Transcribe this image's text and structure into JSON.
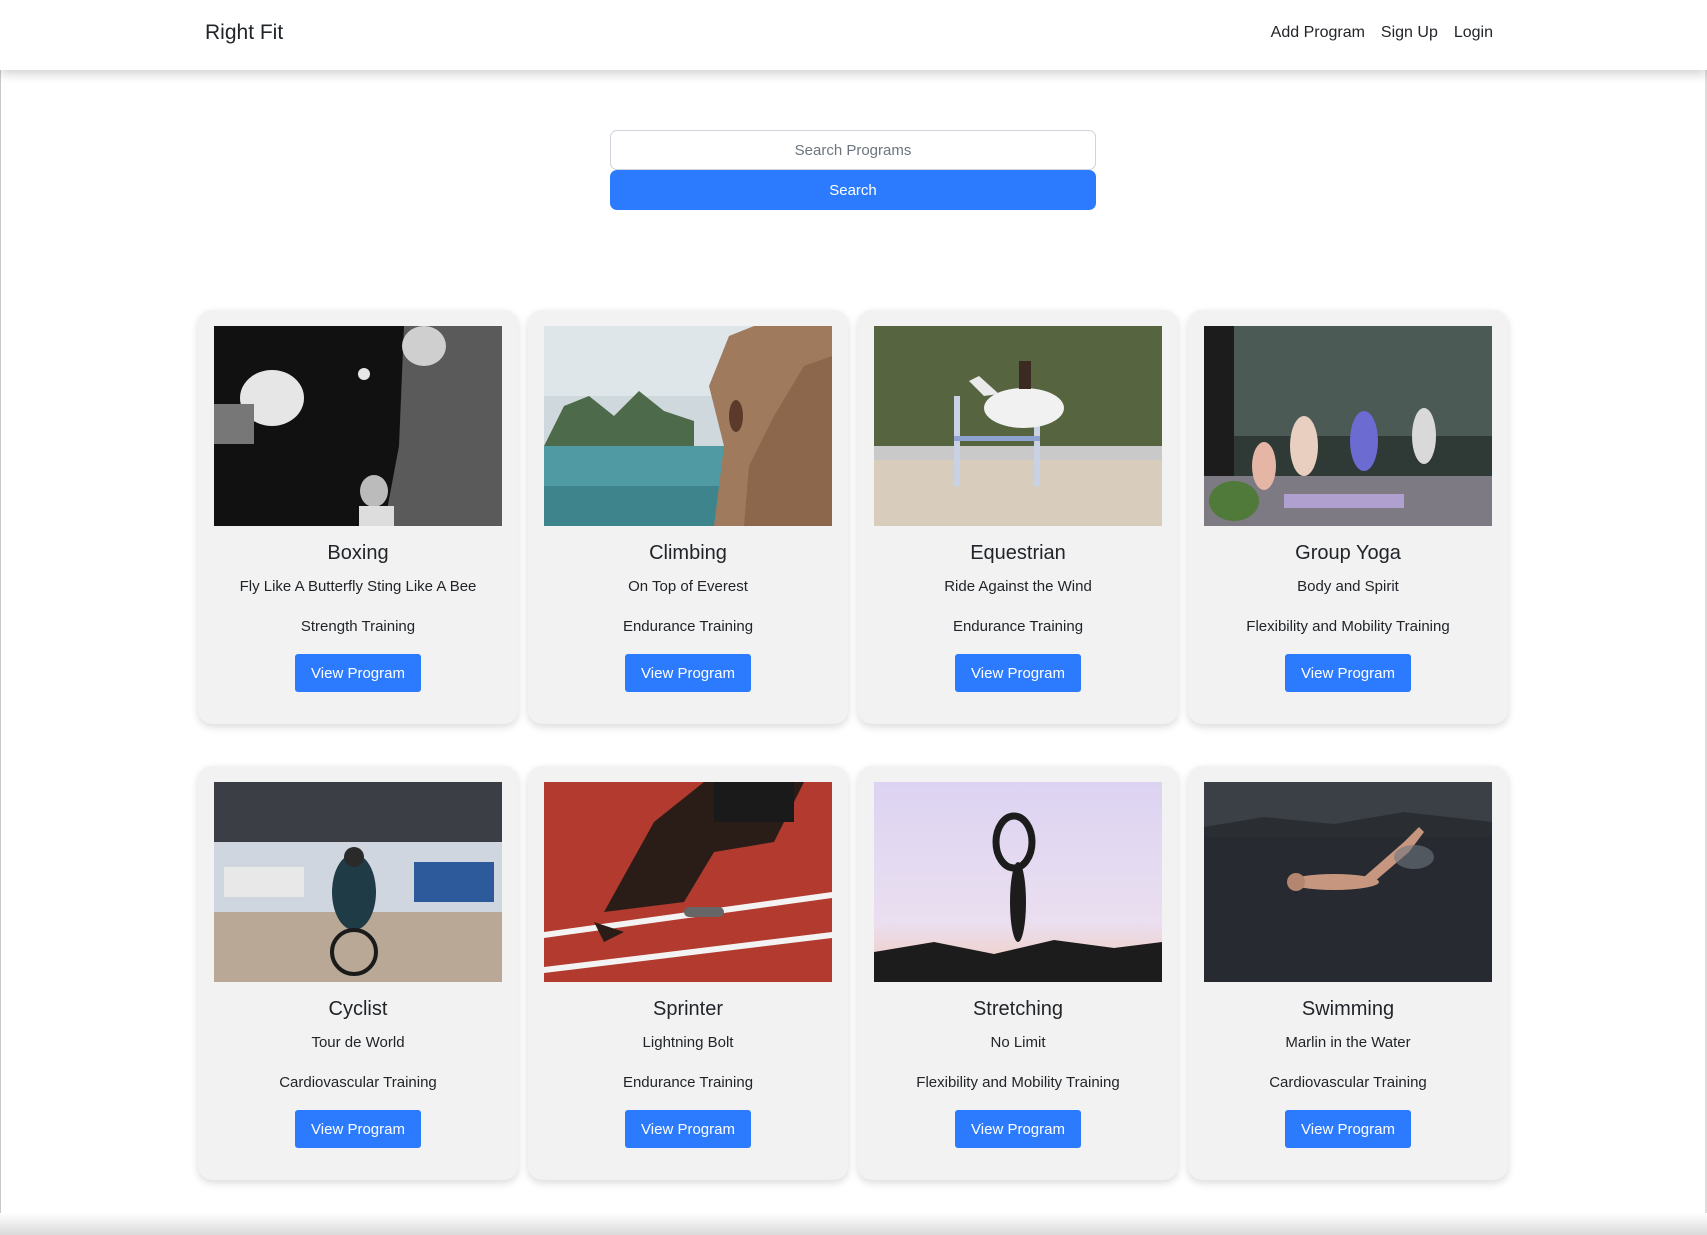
{
  "navbar": {
    "brand": "Right Fit",
    "links": [
      "Add Program",
      "Sign Up",
      "Login"
    ]
  },
  "search": {
    "placeholder": "Search Programs",
    "button_label": "Search"
  },
  "programs": [
    {
      "title": "Boxing",
      "tagline": "Fly Like A Butterfly Sting Like A Bee",
      "category": "Strength Training",
      "button": "View Program",
      "image": "boxing-photo"
    },
    {
      "title": "Climbing",
      "tagline": "On Top of Everest",
      "category": "Endurance Training",
      "button": "View Program",
      "image": "climbing-photo"
    },
    {
      "title": "Equestrian",
      "tagline": "Ride Against the Wind",
      "category": "Endurance Training",
      "button": "View Program",
      "image": "equestrian-photo"
    },
    {
      "title": "Group Yoga",
      "tagline": "Body and Spirit",
      "category": "Flexibility and Mobility Training",
      "button": "View Program",
      "image": "group-yoga-photo"
    },
    {
      "title": "Cyclist",
      "tagline": "Tour de World",
      "category": "Cardiovascular Training",
      "button": "View Program",
      "image": "cyclist-photo"
    },
    {
      "title": "Sprinter",
      "tagline": "Lightning Bolt",
      "category": "Endurance Training",
      "button": "View Program",
      "image": "sprinter-photo"
    },
    {
      "title": "Stretching",
      "tagline": "No Limit",
      "category": "Flexibility and Mobility Training",
      "button": "View Program",
      "image": "stretching-photo"
    },
    {
      "title": "Swimming",
      "tagline": "Marlin in the Water",
      "category": "Cardiovascular Training",
      "button": "View Program",
      "image": "swimming-photo"
    }
  ],
  "colors": {
    "primary": "#2c7bff",
    "card_bg": "#f2f2f2",
    "text": "#212529"
  }
}
